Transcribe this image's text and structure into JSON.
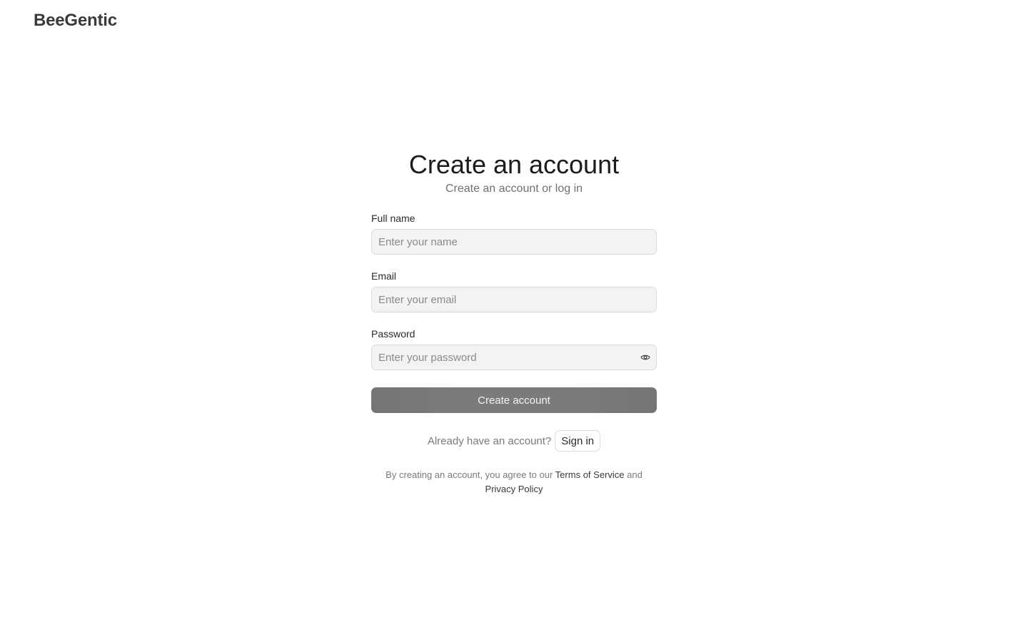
{
  "brand": {
    "name": "BeeGentic"
  },
  "header": {
    "title": "Create an account",
    "subtitle": "Create an account or log in"
  },
  "form": {
    "full_name": {
      "label": "Full name",
      "placeholder": "Enter your name",
      "value": ""
    },
    "email": {
      "label": "Email",
      "placeholder": "Enter your email",
      "value": ""
    },
    "password": {
      "label": "Password",
      "placeholder": "Enter your password",
      "value": "",
      "toggle_icon": "eye-icon"
    },
    "submit_label": "Create account"
  },
  "signin": {
    "prompt": "Already have an account?",
    "button_label": "Sign in"
  },
  "legal": {
    "prefix": "By creating an account, you agree to our",
    "terms_link": "Terms of Service",
    "conjunction": "and",
    "privacy_link": "Privacy Policy"
  },
  "colors": {
    "button_bg": "#787878",
    "input_bg": "#f3f3f3",
    "muted_text": "#7a7a7a"
  }
}
